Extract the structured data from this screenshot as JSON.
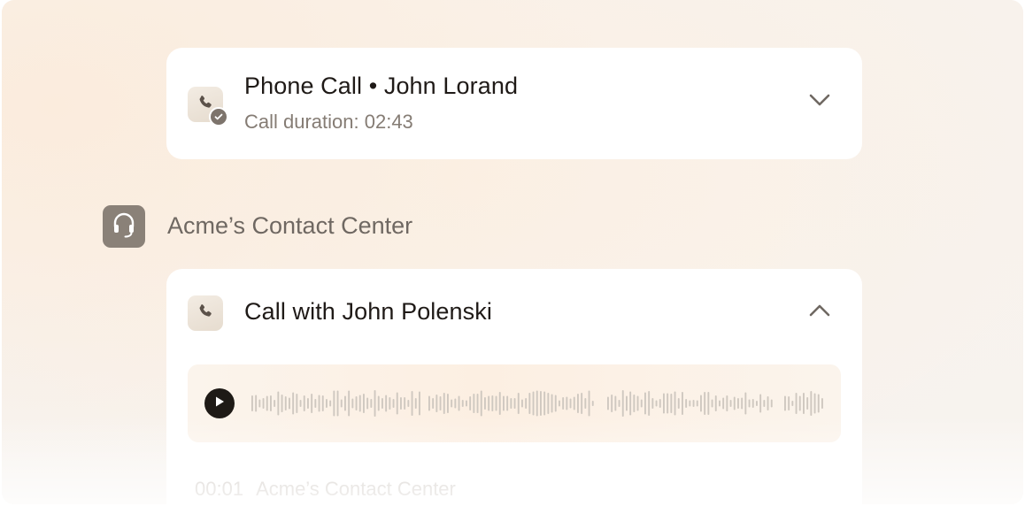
{
  "calls": [
    {
      "title": "Phone Call • John Lorand",
      "subtitle": "Call duration: 02:43",
      "icon": "phone-check-icon",
      "expanded": false,
      "toggle_icon": "chevron-down-icon"
    }
  ],
  "contact_center": {
    "name": "Acme’s Contact Center",
    "icon": "headset-icon"
  },
  "active_call": {
    "title": "Call with John Polenski",
    "icon": "phone-icon",
    "expanded": true,
    "toggle_icon": "chevron-up-icon",
    "player": {
      "play_icon": "play-icon",
      "playback_progress": 0
    },
    "transcript": [
      {
        "time": "00:01",
        "speaker": "Acme’s Contact Center"
      }
    ]
  },
  "colors": {
    "accent_dark": "#1e1a16",
    "muted_brown": "#8a8178",
    "waveform": "#cfc8c0",
    "background_warm": "#fbecdd"
  }
}
